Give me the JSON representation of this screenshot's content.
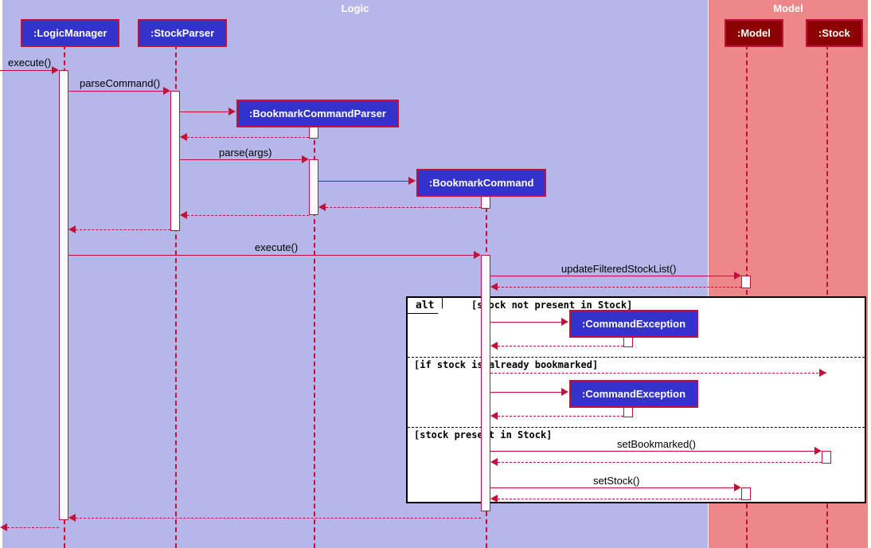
{
  "containers": {
    "logic": "Logic",
    "model": "Model"
  },
  "participants": {
    "logicManager": ":LogicManager",
    "stockParser": ":StockParser",
    "bookmarkCommandParser": ":BookmarkCommandParser",
    "bookmarkCommand": ":BookmarkCommand",
    "commandException1": ":CommandException",
    "commandException2": ":CommandException",
    "model": ":Model",
    "stock": ":Stock"
  },
  "messages": {
    "execute": "execute()",
    "parseCommand": "parseCommand()",
    "parseArgs": "parse(args)",
    "execute2": "execute()",
    "updateFiltered": "updateFilteredStockList()",
    "setBookmarked": "setBookmarked()",
    "setStock": "setStock()"
  },
  "alt": {
    "label": "alt",
    "cond1": "[stock not present in Stock]",
    "cond2": "[if stock is already bookmarked]",
    "cond3": "[stock present in Stock]"
  }
}
